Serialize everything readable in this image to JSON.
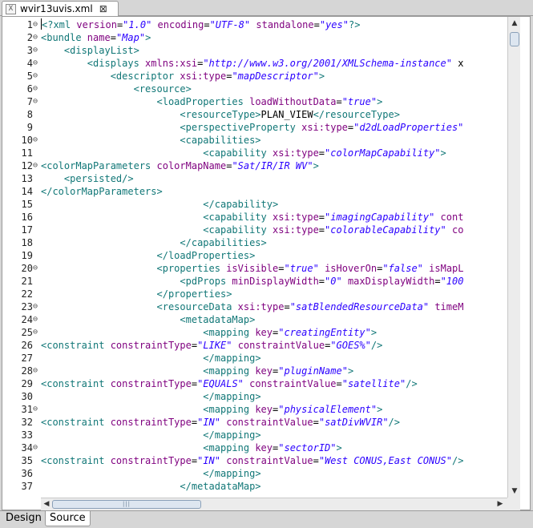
{
  "editor_tab": {
    "icon_label": "X",
    "title": "wvir13uvis.xml",
    "close_glyph": "⊠"
  },
  "bottom_tabs": {
    "design": "Design",
    "source": "Source"
  },
  "scroll": {
    "up": "▲",
    "down": "▼",
    "left": "◀",
    "right": "▶",
    "grip": "|||"
  },
  "folds": [
    "1",
    "2",
    "3",
    "4",
    "5",
    "6",
    "7",
    "10",
    "12",
    "20",
    "23",
    "24",
    "25",
    "28",
    "31",
    "34"
  ],
  "lines": [
    {
      "n": "1",
      "indent": "",
      "segs": [
        [
          "pi",
          "<?xml "
        ],
        [
          "att",
          "version"
        ],
        [
          "txt",
          "="
        ],
        [
          "val",
          "\"1.0\""
        ],
        [
          "txt",
          " "
        ],
        [
          "att",
          "encoding"
        ],
        [
          "txt",
          "="
        ],
        [
          "val",
          "\"UTF-8\""
        ],
        [
          "txt",
          " "
        ],
        [
          "att",
          "standalone"
        ],
        [
          "txt",
          "="
        ],
        [
          "val",
          "\"yes\""
        ],
        [
          "pi",
          "?>"
        ]
      ]
    },
    {
      "n": "2",
      "indent": "",
      "segs": [
        [
          "tag",
          "<bundle "
        ],
        [
          "att",
          "name"
        ],
        [
          "txt",
          "="
        ],
        [
          "val",
          "\"Map\""
        ],
        [
          "tag",
          ">"
        ]
      ]
    },
    {
      "n": "3",
      "indent": "    ",
      "segs": [
        [
          "tag",
          "<displayList>"
        ]
      ]
    },
    {
      "n": "4",
      "indent": "        ",
      "segs": [
        [
          "tag",
          "<displays "
        ],
        [
          "att",
          "xmlns:xsi"
        ],
        [
          "txt",
          "="
        ],
        [
          "val",
          "\"http://www.w3.org/2001/XMLSchema-instance\""
        ],
        [
          "txt",
          " x"
        ]
      ]
    },
    {
      "n": "5",
      "indent": "            ",
      "segs": [
        [
          "tag",
          "<descriptor "
        ],
        [
          "att",
          "xsi:type"
        ],
        [
          "txt",
          "="
        ],
        [
          "val",
          "\"mapDescriptor\""
        ],
        [
          "tag",
          ">"
        ]
      ]
    },
    {
      "n": "6",
      "indent": "                ",
      "segs": [
        [
          "tag",
          "<resource>"
        ]
      ]
    },
    {
      "n": "7",
      "indent": "                    ",
      "segs": [
        [
          "tag",
          "<loadProperties "
        ],
        [
          "att",
          "loadWithoutData"
        ],
        [
          "txt",
          "="
        ],
        [
          "val",
          "\"true\""
        ],
        [
          "tag",
          ">"
        ]
      ]
    },
    {
      "n": "8",
      "indent": "                        ",
      "segs": [
        [
          "tag",
          "<resourceType>"
        ],
        [
          "txt",
          "PLAN_VIEW"
        ],
        [
          "tag",
          "</resourceType>"
        ]
      ]
    },
    {
      "n": "9",
      "indent": "                        ",
      "segs": [
        [
          "tag",
          "<perspectiveProperty "
        ],
        [
          "att",
          "xsi:type"
        ],
        [
          "txt",
          "="
        ],
        [
          "val",
          "\"d2dLoadProperties\""
        ]
      ]
    },
    {
      "n": "10",
      "indent": "                        ",
      "segs": [
        [
          "tag",
          "<capabilities>"
        ]
      ]
    },
    {
      "n": "11",
      "indent": "                            ",
      "segs": [
        [
          "tag",
          "<capability "
        ],
        [
          "att",
          "xsi:type"
        ],
        [
          "txt",
          "="
        ],
        [
          "val",
          "\"colorMapCapability\""
        ],
        [
          "tag",
          ">"
        ]
      ]
    },
    {
      "n": "12",
      "indent": "",
      "segs": [
        [
          "tag",
          "<colorMapParameters "
        ],
        [
          "att",
          "colorMapName"
        ],
        [
          "txt",
          "="
        ],
        [
          "val",
          "\"Sat/IR/IR WV\""
        ],
        [
          "tag",
          ">"
        ]
      ]
    },
    {
      "n": "13",
      "indent": "    ",
      "segs": [
        [
          "tag",
          "<persisted/>"
        ]
      ]
    },
    {
      "n": "14",
      "indent": "",
      "segs": [
        [
          "tag",
          "</colorMapParameters>"
        ]
      ]
    },
    {
      "n": "15",
      "indent": "                            ",
      "segs": [
        [
          "tag",
          "</capability>"
        ]
      ]
    },
    {
      "n": "16",
      "indent": "                            ",
      "segs": [
        [
          "tag",
          "<capability "
        ],
        [
          "att",
          "xsi:type"
        ],
        [
          "txt",
          "="
        ],
        [
          "val",
          "\"imagingCapability\""
        ],
        [
          "txt",
          " "
        ],
        [
          "att",
          "cont"
        ]
      ]
    },
    {
      "n": "17",
      "indent": "                            ",
      "segs": [
        [
          "tag",
          "<capability "
        ],
        [
          "att",
          "xsi:type"
        ],
        [
          "txt",
          "="
        ],
        [
          "val",
          "\"colorableCapability\""
        ],
        [
          "txt",
          " "
        ],
        [
          "att",
          "co"
        ]
      ]
    },
    {
      "n": "18",
      "indent": "                        ",
      "segs": [
        [
          "tag",
          "</capabilities>"
        ]
      ]
    },
    {
      "n": "19",
      "indent": "                    ",
      "segs": [
        [
          "tag",
          "</loadProperties>"
        ]
      ]
    },
    {
      "n": "20",
      "indent": "                    ",
      "segs": [
        [
          "tag",
          "<properties "
        ],
        [
          "att",
          "isVisible"
        ],
        [
          "txt",
          "="
        ],
        [
          "val",
          "\"true\""
        ],
        [
          "txt",
          " "
        ],
        [
          "att",
          "isHoverOn"
        ],
        [
          "txt",
          "="
        ],
        [
          "val",
          "\"false\""
        ],
        [
          "txt",
          " "
        ],
        [
          "att",
          "isMapL"
        ]
      ]
    },
    {
      "n": "21",
      "indent": "                        ",
      "segs": [
        [
          "tag",
          "<pdProps "
        ],
        [
          "att",
          "minDisplayWidth"
        ],
        [
          "txt",
          "="
        ],
        [
          "val",
          "\"0\""
        ],
        [
          "txt",
          " "
        ],
        [
          "att",
          "maxDisplayWidth"
        ],
        [
          "txt",
          "="
        ],
        [
          "val",
          "\"100"
        ]
      ]
    },
    {
      "n": "22",
      "indent": "                    ",
      "segs": [
        [
          "tag",
          "</properties>"
        ]
      ]
    },
    {
      "n": "23",
      "indent": "                    ",
      "segs": [
        [
          "tag",
          "<resourceData "
        ],
        [
          "att",
          "xsi:type"
        ],
        [
          "txt",
          "="
        ],
        [
          "val",
          "\"satBlendedResourceData\""
        ],
        [
          "txt",
          " "
        ],
        [
          "att",
          "timeM"
        ]
      ]
    },
    {
      "n": "24",
      "indent": "                        ",
      "segs": [
        [
          "tag",
          "<metadataMap>"
        ]
      ]
    },
    {
      "n": "25",
      "indent": "                            ",
      "segs": [
        [
          "tag",
          "<mapping "
        ],
        [
          "att",
          "key"
        ],
        [
          "txt",
          "="
        ],
        [
          "val",
          "\"creatingEntity\""
        ],
        [
          "tag",
          ">"
        ]
      ]
    },
    {
      "n": "26",
      "indent": "",
      "segs": [
        [
          "tag",
          "<constraint "
        ],
        [
          "att",
          "constraintType"
        ],
        [
          "txt",
          "="
        ],
        [
          "val",
          "\"LIKE\""
        ],
        [
          "txt",
          " "
        ],
        [
          "att",
          "constraintValue"
        ],
        [
          "txt",
          "="
        ],
        [
          "val",
          "\"GOES%\""
        ],
        [
          "tag",
          "/>"
        ]
      ]
    },
    {
      "n": "27",
      "indent": "                            ",
      "segs": [
        [
          "tag",
          "</mapping>"
        ]
      ]
    },
    {
      "n": "28",
      "indent": "                            ",
      "segs": [
        [
          "tag",
          "<mapping "
        ],
        [
          "att",
          "key"
        ],
        [
          "txt",
          "="
        ],
        [
          "val",
          "\"pluginName\""
        ],
        [
          "tag",
          ">"
        ]
      ]
    },
    {
      "n": "29",
      "indent": "",
      "segs": [
        [
          "tag",
          "<constraint "
        ],
        [
          "att",
          "constraintType"
        ],
        [
          "txt",
          "="
        ],
        [
          "val",
          "\"EQUALS\""
        ],
        [
          "txt",
          " "
        ],
        [
          "att",
          "constraintValue"
        ],
        [
          "txt",
          "="
        ],
        [
          "val",
          "\"satellite\""
        ],
        [
          "tag",
          "/>"
        ]
      ]
    },
    {
      "n": "30",
      "indent": "                            ",
      "segs": [
        [
          "tag",
          "</mapping>"
        ]
      ]
    },
    {
      "n": "31",
      "indent": "                            ",
      "segs": [
        [
          "tag",
          "<mapping "
        ],
        [
          "att",
          "key"
        ],
        [
          "txt",
          "="
        ],
        [
          "val",
          "\"physicalElement\""
        ],
        [
          "tag",
          ">"
        ]
      ]
    },
    {
      "n": "32",
      "indent": "",
      "segs": [
        [
          "tag",
          "<constraint "
        ],
        [
          "att",
          "constraintType"
        ],
        [
          "txt",
          "="
        ],
        [
          "val",
          "\"IN\""
        ],
        [
          "txt",
          " "
        ],
        [
          "att",
          "constraintValue"
        ],
        [
          "txt",
          "="
        ],
        [
          "val",
          "\"satDivWVIR\""
        ],
        [
          "tag",
          "/>"
        ]
      ]
    },
    {
      "n": "33",
      "indent": "                            ",
      "segs": [
        [
          "tag",
          "</mapping>"
        ]
      ]
    },
    {
      "n": "34",
      "indent": "                            ",
      "segs": [
        [
          "tag",
          "<mapping "
        ],
        [
          "att",
          "key"
        ],
        [
          "txt",
          "="
        ],
        [
          "val",
          "\"sectorID\""
        ],
        [
          "tag",
          ">"
        ]
      ]
    },
    {
      "n": "35",
      "indent": "",
      "segs": [
        [
          "tag",
          "<constraint "
        ],
        [
          "att",
          "constraintType"
        ],
        [
          "txt",
          "="
        ],
        [
          "val",
          "\"IN\""
        ],
        [
          "txt",
          " "
        ],
        [
          "att",
          "constraintValue"
        ],
        [
          "txt",
          "="
        ],
        [
          "val",
          "\"West CONUS,East CONUS\""
        ],
        [
          "tag",
          "/>"
        ]
      ]
    },
    {
      "n": "36",
      "indent": "                            ",
      "segs": [
        [
          "tag",
          "</mapping>"
        ]
      ]
    },
    {
      "n": "37",
      "indent": "                        ",
      "segs": [
        [
          "tag",
          "</metadataMap>"
        ]
      ]
    }
  ]
}
